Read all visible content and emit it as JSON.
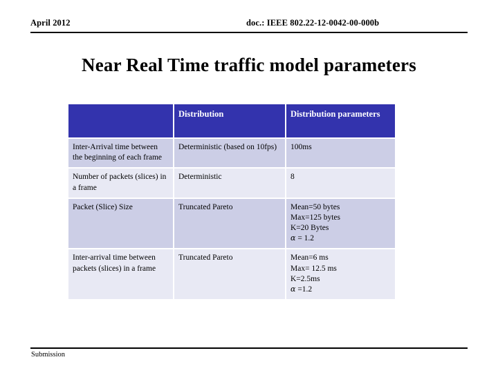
{
  "header": {
    "date": "April 2012",
    "doc": "doc.:  IEEE 802.22-12-0042-00-000b"
  },
  "title": "Near Real Time traffic model parameters",
  "table": {
    "columns": [
      "",
      "Distribution",
      "Distribution parameters"
    ],
    "header_bg": "#3333AD",
    "header_text_color": "#FFFFFF",
    "row_bg_dark": "#CCCEE6",
    "row_bg_light": "#E8E9F4",
    "rows": [
      {
        "name": "Inter-Arrival time between the beginning of each frame",
        "distribution": "Deterministic (based on 10fps)",
        "parameters": [
          "100ms"
        ]
      },
      {
        "name": "Number of packets (slices) in a frame",
        "distribution": "Deterministic",
        "parameters": [
          "8"
        ]
      },
      {
        "name": "Packet (Slice) Size",
        "distribution": "Truncated Pareto",
        "parameters": [
          "Mean=50 bytes",
          "Max=125 bytes",
          "K=20 Bytes",
          "α  = 1.2"
        ]
      },
      {
        "name": "Inter-arrival time between packets (slices) in a frame",
        "distribution": "Truncated Pareto",
        "parameters": [
          "Mean=6 ms",
          "Max= 12.5 ms",
          "K=2.5ms",
          "α =1.2"
        ]
      }
    ]
  },
  "footer": {
    "text": "Submission"
  }
}
